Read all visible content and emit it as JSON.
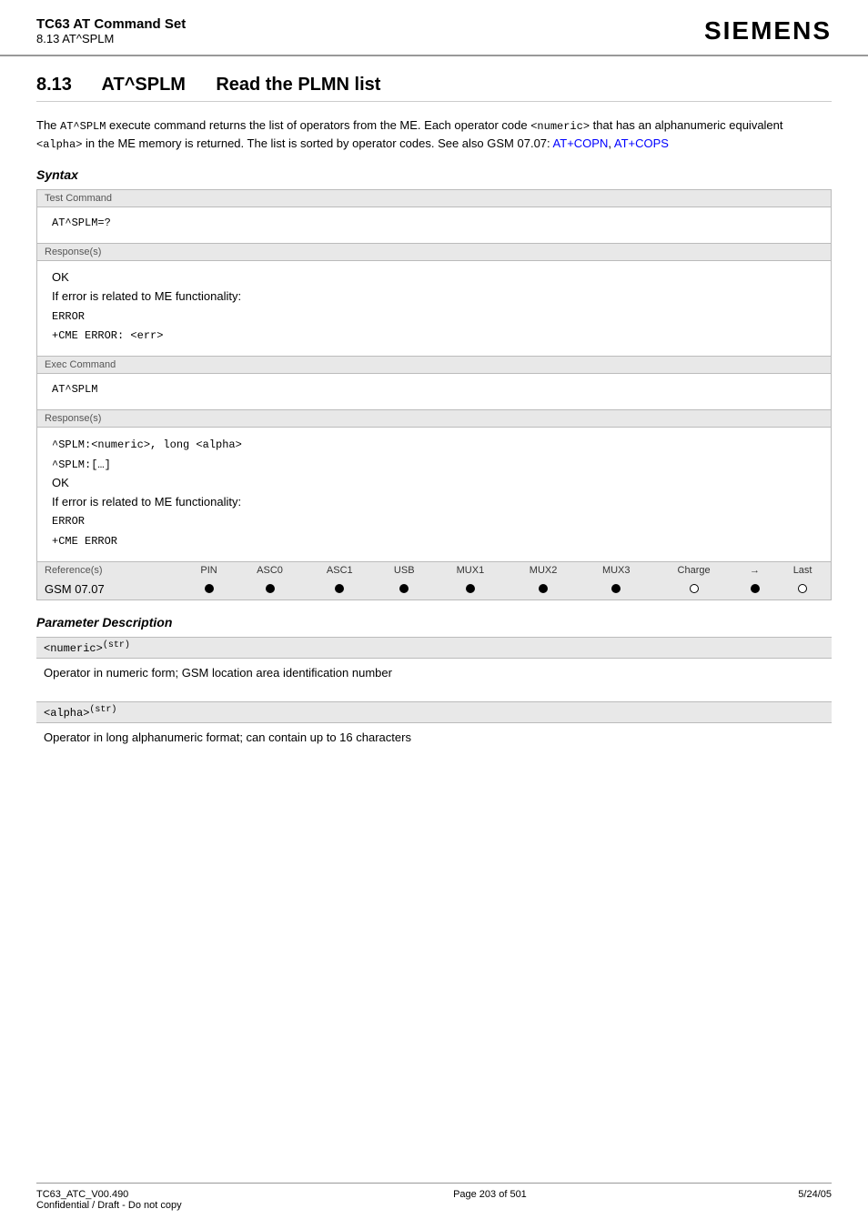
{
  "header": {
    "title": "TC63 AT Command Set",
    "subtitle": "8.13 AT^SPLM",
    "logo": "SIEMENS"
  },
  "section": {
    "number": "8.13",
    "title": "AT^SPLM",
    "subtitle": "Read the PLMN list"
  },
  "intro": {
    "text1": "The ",
    "cmd_main": "AT^SPLM",
    "text2": " execute command returns the list of operators from the ME. Each operator code ",
    "cmd_numeric": "<numeric>",
    "text3": " that has an alphanumeric equivalent ",
    "cmd_alpha": "<alpha>",
    "text4": " in the ME memory is returned. The list is sorted by operator codes. See also GSM 07.07: ",
    "link1": "AT+COPN",
    "text5": ", ",
    "link2": "AT+COPS"
  },
  "syntax": {
    "heading": "Syntax",
    "test_label": "Test Command",
    "test_cmd": "AT^SPLM=?",
    "test_response_label": "Response(s)",
    "test_response": "OK\nIf error is related to ME functionality:\nERROR\n+CME ERROR: <err>",
    "exec_label": "Exec Command",
    "exec_cmd": "AT^SPLM",
    "exec_response_label": "Response(s)",
    "exec_response_line1": "^SPLM:<numeric>, long <alpha>",
    "exec_response_line2": "^SPLM:[…]",
    "exec_response_line3": "OK",
    "exec_response_line4": "If error is related to ME functionality:",
    "exec_response_line5": "ERROR",
    "exec_response_line6": "+CME ERROR",
    "ref_label": "Reference(s)",
    "ref_value": "GSM 07.07",
    "col_headers": [
      "PIN",
      "ASC0",
      "ASC1",
      "USB",
      "MUX1",
      "MUX2",
      "MUX3",
      "Charge",
      "→",
      "Last"
    ],
    "col_dots": [
      "filled",
      "filled",
      "filled",
      "filled",
      "filled",
      "filled",
      "filled",
      "empty",
      "filled",
      "empty"
    ]
  },
  "param_description": {
    "heading": "Parameter Description",
    "params": [
      {
        "label": "<numeric>",
        "superscript": "(str)",
        "description": "Operator in numeric form; GSM location area identification number"
      },
      {
        "label": "<alpha>",
        "superscript": "(str)",
        "description": "Operator in long alphanumeric format; can contain up to 16 characters"
      }
    ]
  },
  "footer": {
    "left_line1": "TC63_ATC_V00.490",
    "left_line2": "Confidential / Draft - Do not copy",
    "center": "Page 203 of 501",
    "right": "5/24/05"
  }
}
